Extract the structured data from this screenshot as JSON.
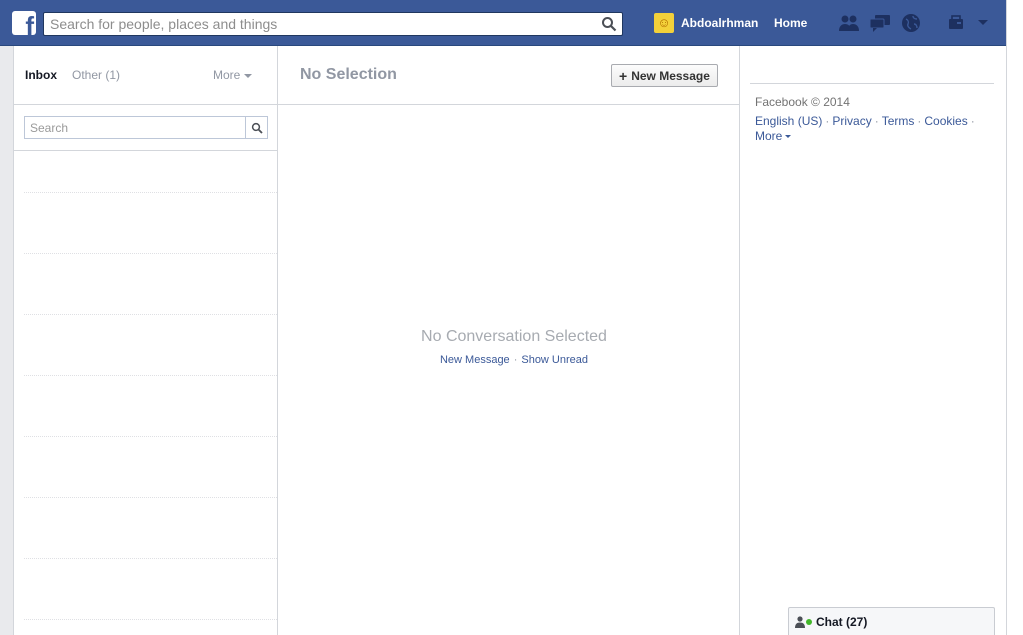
{
  "header": {
    "logo_letter": "f",
    "search_placeholder": "Search for people, places and things",
    "profile_name": "Abdoalrhman",
    "home_label": "Home",
    "icons": [
      "friend-requests-icon",
      "messages-icon",
      "notifications-icon",
      "privacy-shortcuts-icon",
      "account-settings-icon"
    ]
  },
  "messages": {
    "tabs": {
      "inbox": "Inbox",
      "other": "Other (1)",
      "more": "More"
    },
    "search_placeholder": "Search",
    "thread_rows": 8
  },
  "conversation": {
    "title": "No Selection",
    "new_message_button": "New Message",
    "empty_title": "No Conversation Selected",
    "empty_link_new": "New Message",
    "empty_link_separator": "·",
    "empty_link_unread": "Show Unread"
  },
  "footer": {
    "copyright": "Facebook © 2014",
    "links": [
      "English (US)",
      "Privacy",
      "Terms",
      "Cookies",
      "More"
    ],
    "separator": "·"
  },
  "chat": {
    "label": "Chat (27)"
  },
  "colors": {
    "brand_blue": "#3b5998",
    "online_green": "#42b72a",
    "muted_gray": "#9197a3"
  }
}
